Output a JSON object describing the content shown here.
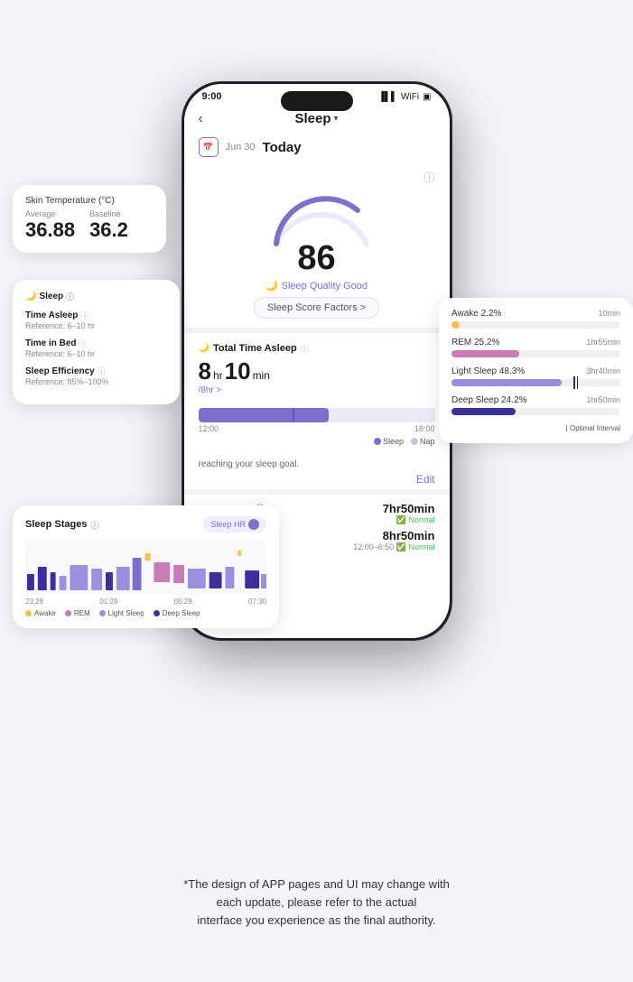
{
  "app": {
    "status_time": "9:00",
    "header_title": "Sleep",
    "back_label": "‹",
    "date_prefix": "Jun 30",
    "date_today": "Today",
    "score": "86",
    "sleep_quality": "Sleep Quality Good",
    "score_factors_btn": "Sleep Score Factors >",
    "info_icon": "ⓘ"
  },
  "total_time": {
    "section_title": "Total Time Asleep",
    "hours": "8",
    "minutes": "10",
    "hr_label": "hr",
    "min_label": "min",
    "goal_text": "/8hr >",
    "timeline_start": "12:00",
    "timeline_end": "18:00",
    "legend_sleep": "Sleep",
    "legend_nap": "Nap",
    "reaching_goal": "reaching your sleep goal.",
    "edit_label": "Edit"
  },
  "sleep_metrics": {
    "time_asleep_label": "7hr50min",
    "time_asleep_status": "Normal",
    "time_in_bed_label": "8hr50min",
    "time_in_bed_range": "12:00–6:50",
    "time_in_bed_status": "Normal",
    "reference_label": "Reference: 6–10 hr"
  },
  "skin_temp_card": {
    "title": "Skin Temperature (°C)",
    "avg_label": "Average",
    "baseline_label": "Baseline",
    "avg_value": "36.88",
    "baseline_value": "36.2"
  },
  "sleep_card": {
    "title": "Sleep",
    "time_asleep_label": "Time Asleep",
    "time_asleep_ref": "Reference: 6–10 hr",
    "time_in_bed_label": "Time in Bed",
    "time_in_bed_ref": "Reference: 6–10 hr",
    "efficiency_label": "Sleep Efficiency",
    "efficiency_ref": "Reference: 85%–100%"
  },
  "sleep_stages_card": {
    "title": "Sleep Stages",
    "toggle_label": "Sleep HR",
    "time_labels": [
      "23:28",
      "01:29",
      "05:29",
      "07:30"
    ],
    "legend": [
      {
        "label": "Awake",
        "color": "#f5c04e"
      },
      {
        "label": "REM",
        "color": "#c97bb8"
      },
      {
        "label": "Light Sleep",
        "color": "#9b8fe0"
      },
      {
        "label": "Deep Sleep",
        "color": "#3b2f9e"
      }
    ]
  },
  "sleep_breakdown_card": {
    "rows": [
      {
        "label": "Awake",
        "pct": "2.2%",
        "time": "10min",
        "fill_width": 5,
        "color": "#f5c04e"
      },
      {
        "label": "REM",
        "pct": "25.2%",
        "time": "1hr55min",
        "fill_width": 40,
        "color": "#c97bb8"
      },
      {
        "label": "Light Sleep",
        "pct": "48.3%",
        "time": "3hr40min",
        "fill_width": 65,
        "color": "#9b8fe0"
      },
      {
        "label": "Deep Sleep",
        "pct": "24.2%",
        "time": "1hr50min",
        "fill_width": 38,
        "color": "#3b2f9e"
      }
    ],
    "optimal_label": "| Optimal Interval"
  },
  "disclaimer": "*The design of APP pages and UI may change with\neach update, please refer to the actual\ninterface you experience as the final authority."
}
